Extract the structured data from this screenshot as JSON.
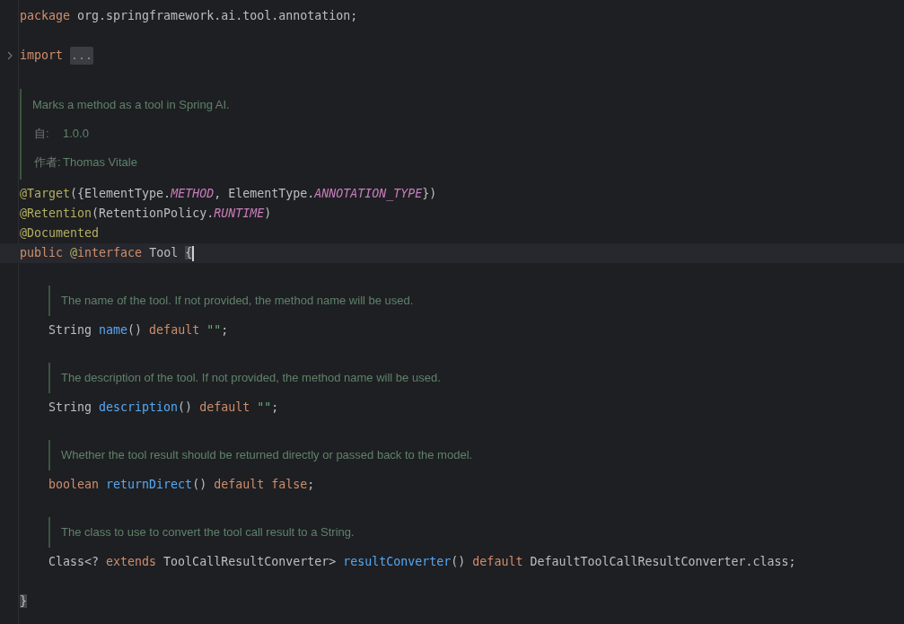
{
  "lines": [
    {
      "kind": "code",
      "tokens": [
        {
          "kind": "keyword",
          "text": "package"
        },
        {
          "kind": "plain",
          "text": " org.springframework.ai.tool.annotation;"
        }
      ]
    },
    {
      "kind": "blank"
    },
    {
      "kind": "code",
      "collapsed": true,
      "tokens": [
        {
          "kind": "keyword",
          "text": "import"
        },
        {
          "kind": "fold",
          "text": "..."
        }
      ]
    },
    {
      "kind": "doc",
      "items": [
        {
          "kind": "text",
          "text": "Marks a method as a tool in Spring AI."
        },
        {
          "kind": "field",
          "label": "自:",
          "value": "1.0.0"
        },
        {
          "kind": "field",
          "label": "作者:",
          "value": "Thomas Vitale"
        }
      ]
    },
    {
      "kind": "code",
      "tokens": [
        {
          "kind": "annotation",
          "text": "@Target"
        },
        {
          "kind": "plain",
          "text": "({ElementType."
        },
        {
          "kind": "constant",
          "text": "METHOD"
        },
        {
          "kind": "plain",
          "text": ", ElementType."
        },
        {
          "kind": "constant",
          "text": "ANNOTATION_TYPE"
        },
        {
          "kind": "plain",
          "text": "})"
        }
      ]
    },
    {
      "kind": "code",
      "tokens": [
        {
          "kind": "annotation",
          "text": "@Retention"
        },
        {
          "kind": "plain",
          "text": "(RetentionPolicy."
        },
        {
          "kind": "constant",
          "text": "RUNTIME"
        },
        {
          "kind": "plain",
          "text": ")"
        }
      ]
    },
    {
      "kind": "code",
      "tokens": [
        {
          "kind": "annotation",
          "text": "@Documented"
        }
      ]
    },
    {
      "kind": "code",
      "current": true,
      "caret": true,
      "tokens": [
        {
          "kind": "keyword",
          "text": "public"
        },
        {
          "kind": "annotation",
          "text": " @"
        },
        {
          "kind": "keyword",
          "text": "interface"
        },
        {
          "kind": "plain",
          "text": " Tool "
        },
        {
          "kind": "brace_match",
          "text": "{"
        }
      ],
      "children": [
        {
          "kind": "doc",
          "items": [
            {
              "kind": "text",
              "text": "The name of the tool. If not provided, the method name will be used."
            }
          ]
        },
        {
          "kind": "code",
          "tokens": [
            {
              "kind": "plain",
              "text": "String "
            },
            {
              "kind": "method",
              "text": "name"
            },
            {
              "kind": "plain",
              "text": "() "
            },
            {
              "kind": "keyword",
              "text": "default"
            },
            {
              "kind": "string",
              "text": " \"\""
            },
            {
              "kind": "plain",
              "text": ";"
            }
          ]
        },
        {
          "kind": "doc",
          "items": [
            {
              "kind": "text",
              "text": "The description of the tool. If not provided, the method name will be used."
            }
          ]
        },
        {
          "kind": "code",
          "tokens": [
            {
              "kind": "plain",
              "text": "String "
            },
            {
              "kind": "method",
              "text": "description"
            },
            {
              "kind": "plain",
              "text": "() "
            },
            {
              "kind": "keyword",
              "text": "default"
            },
            {
              "kind": "string",
              "text": " \"\""
            },
            {
              "kind": "plain",
              "text": ";"
            }
          ]
        },
        {
          "kind": "doc",
          "items": [
            {
              "kind": "text",
              "text": "Whether the tool result should be returned directly or passed back to the model."
            }
          ]
        },
        {
          "kind": "code",
          "tokens": [
            {
              "kind": "keyword",
              "text": "boolean"
            },
            {
              "kind": "method",
              "text": " returnDirect"
            },
            {
              "kind": "plain",
              "text": "() "
            },
            {
              "kind": "keyword",
              "text": "default false"
            },
            {
              "kind": "plain",
              "text": ";"
            }
          ]
        },
        {
          "kind": "doc",
          "items": [
            {
              "kind": "text",
              "text": "The class to use to convert the tool call result to a String."
            }
          ]
        },
        {
          "kind": "code",
          "tokens": [
            {
              "kind": "plain",
              "text": "Class<? "
            },
            {
              "kind": "keyword",
              "text": "extends"
            },
            {
              "kind": "plain",
              "text": " ToolCallResultConverter> "
            },
            {
              "kind": "method",
              "text": "resultConverter"
            },
            {
              "kind": "plain",
              "text": "() "
            },
            {
              "kind": "keyword",
              "text": "default"
            },
            {
              "kind": "plain",
              "text": " DefaultToolCallResultConverter.class;"
            }
          ]
        },
        {
          "kind": "blank"
        }
      ]
    },
    {
      "kind": "code",
      "tokens": [
        {
          "kind": "brace_match",
          "text": "}"
        }
      ]
    }
  ]
}
